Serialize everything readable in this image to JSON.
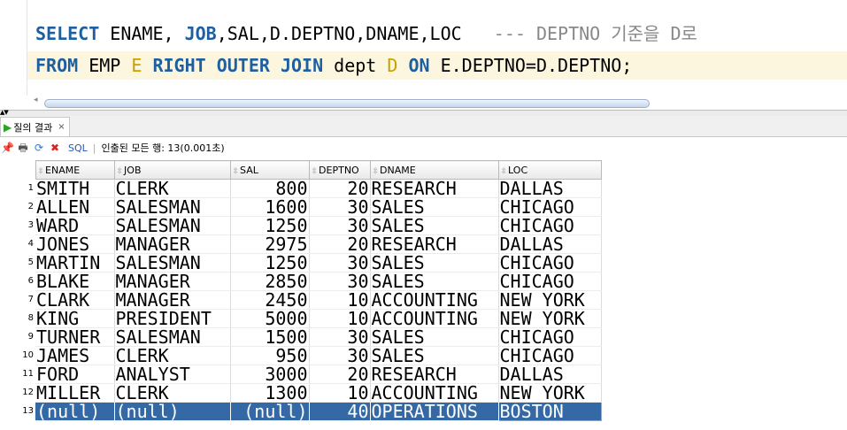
{
  "editor": {
    "line1": {
      "kw_select": "SELECT",
      "cols_a": " ENAME, ",
      "kw_job": "JOB",
      "cols_b": ",SAL,D.DEPTNO,DNAME,LOC",
      "comment": "   --- DEPTNO 기준을 D로"
    },
    "line2": {
      "kw_from": "FROM",
      "emp": " EMP ",
      "alias_e": "E",
      "kw_join": " RIGHT OUTER JOIN",
      "dept": " dept ",
      "alias_d": "D",
      "kw_on": " ON",
      "cond": " E.DEPTNO=D.DEPTNO;"
    }
  },
  "results_tab": {
    "label": "질의 결과",
    "close": "×"
  },
  "toolbar": {
    "sql_label": "SQL",
    "status": "인출된 모든 행: 13(0.001초)"
  },
  "grid": {
    "columns": [
      "ENAME",
      "JOB",
      "SAL",
      "DEPTNO",
      "DNAME",
      "LOC"
    ],
    "rows": [
      [
        "1",
        "SMITH",
        "CLERK",
        "800",
        "20",
        "RESEARCH",
        "DALLAS"
      ],
      [
        "2",
        "ALLEN",
        "SALESMAN",
        "1600",
        "30",
        "SALES",
        "CHICAGO"
      ],
      [
        "3",
        "WARD",
        "SALESMAN",
        "1250",
        "30",
        "SALES",
        "CHICAGO"
      ],
      [
        "4",
        "JONES",
        "MANAGER",
        "2975",
        "20",
        "RESEARCH",
        "DALLAS"
      ],
      [
        "5",
        "MARTIN",
        "SALESMAN",
        "1250",
        "30",
        "SALES",
        "CHICAGO"
      ],
      [
        "6",
        "BLAKE",
        "MANAGER",
        "2850",
        "30",
        "SALES",
        "CHICAGO"
      ],
      [
        "7",
        "CLARK",
        "MANAGER",
        "2450",
        "10",
        "ACCOUNTING",
        "NEW YORK"
      ],
      [
        "8",
        "KING",
        "PRESIDENT",
        "5000",
        "10",
        "ACCOUNTING",
        "NEW YORK"
      ],
      [
        "9",
        "TURNER",
        "SALESMAN",
        "1500",
        "30",
        "SALES",
        "CHICAGO"
      ],
      [
        "10",
        "JAMES",
        "CLERK",
        "950",
        "30",
        "SALES",
        "CHICAGO"
      ],
      [
        "11",
        "FORD",
        "ANALYST",
        "3000",
        "20",
        "RESEARCH",
        "DALLAS"
      ],
      [
        "12",
        "MILLER",
        "CLERK",
        "1300",
        "10",
        "ACCOUNTING",
        "NEW YORK"
      ],
      [
        "13",
        "(null)",
        "(null)",
        "(null)",
        "40",
        "OPERATIONS",
        "BOSTON"
      ]
    ],
    "selected_row": "13"
  },
  "colors": {
    "keyword": "#1f5f9f",
    "alias": "#c6a100",
    "comment": "#888888",
    "selection": "#3469a6"
  }
}
